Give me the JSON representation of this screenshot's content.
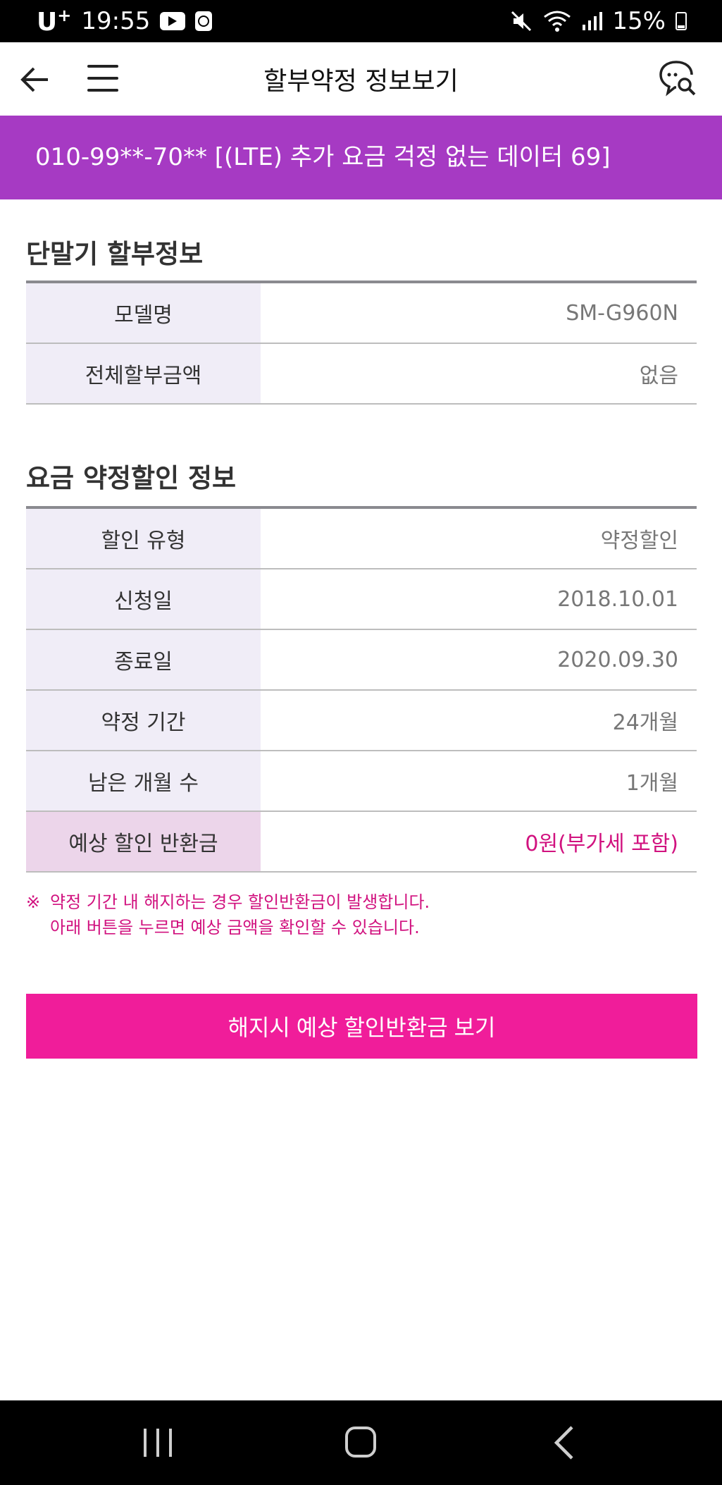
{
  "status_bar": {
    "carrier": "U",
    "carrier_sup": "+",
    "time": "19:55",
    "battery": "15%"
  },
  "header": {
    "title": "할부약정 정보보기"
  },
  "banner": {
    "text": "010-99**-70** [(LTE) 추가 요금 걱정 없는 데이터 69]"
  },
  "device_section": {
    "title": "단말기 할부정보",
    "rows": [
      {
        "label": "모델명",
        "value": "SM-G960N"
      },
      {
        "label": "전체할부금액",
        "value": "없음"
      }
    ]
  },
  "discount_section": {
    "title": "요금 약정할인 정보",
    "rows": [
      {
        "label": "할인 유형",
        "value": "약정할인"
      },
      {
        "label": "신청일",
        "value": "2018.10.01"
      },
      {
        "label": "종료일",
        "value": "2020.09.30"
      },
      {
        "label": "약정 기간",
        "value": "24개월"
      },
      {
        "label": "남은 개월 수",
        "value": "1개월"
      },
      {
        "label": "예상 할인 반환금",
        "value": "0원(부가세 포함)"
      }
    ]
  },
  "notice": {
    "mark": "※",
    "line1": "약정 기간 내 해지하는 경우 할인반환금이 발생합니다.",
    "line2": "아래 버튼을 누르면 예상 금액을 확인할 수 있습니다."
  },
  "refund_button": {
    "label": "해지시 예상 할인반환금 보기"
  },
  "colors": {
    "banner": "#a63ac3",
    "accent": "#d1127f",
    "button": "#f01d9a"
  }
}
